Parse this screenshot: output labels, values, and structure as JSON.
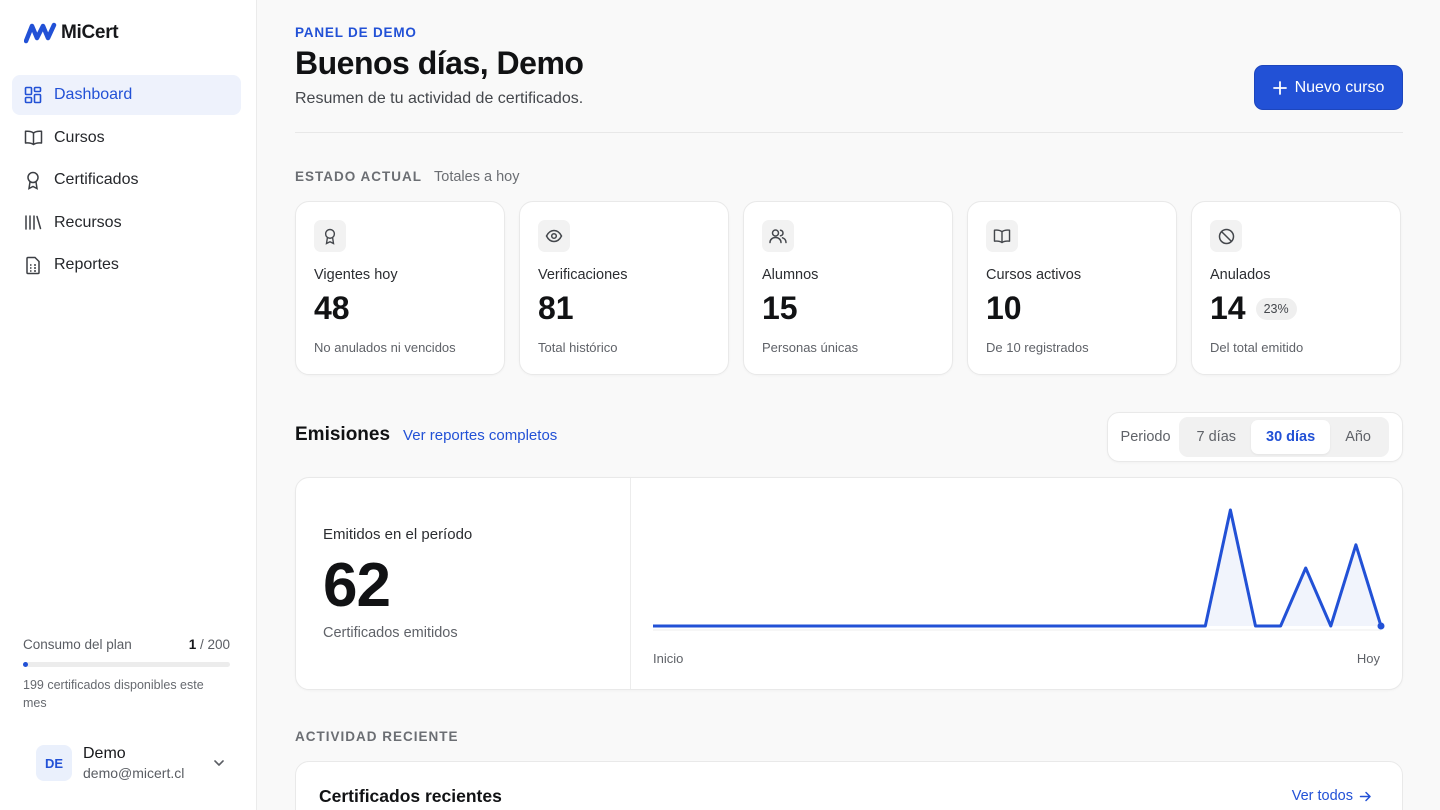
{
  "brand": {
    "name": "MiCert",
    "accent": "#2251d6"
  },
  "sidebar": {
    "items": [
      {
        "label": "Dashboard",
        "icon": "dashboard-grid-icon",
        "active": true
      },
      {
        "label": "Cursos",
        "icon": "book-open-icon"
      },
      {
        "label": "Certificados",
        "icon": "award-icon"
      },
      {
        "label": "Recursos",
        "icon": "library-icon"
      },
      {
        "label": "Reportes",
        "icon": "report-sheet-icon"
      }
    ],
    "plan": {
      "label": "Consumo del plan",
      "used": "1",
      "total": "/ 200",
      "usage_fraction": 0.005,
      "note": "199 certificados disponibles este mes"
    },
    "user": {
      "initials": "DE",
      "name": "Demo",
      "email": "demo@micert.cl"
    }
  },
  "header": {
    "eyebrow": "PANEL DE DEMO",
    "title": "Buenos días, Demo",
    "subtitle": "Resumen de tu actividad de certificados.",
    "new_course_label": "Nuevo curso"
  },
  "status": {
    "label": "ESTADO ACTUAL",
    "hint": "Totales a hoy",
    "cards": [
      {
        "icon": "award-icon",
        "label": "Vigentes hoy",
        "value": "48",
        "note": "No anulados ni vencidos"
      },
      {
        "icon": "eye-icon",
        "label": "Verificaciones",
        "value": "81",
        "note": "Total histórico"
      },
      {
        "icon": "users-icon",
        "label": "Alumnos",
        "value": "15",
        "note": "Personas únicas"
      },
      {
        "icon": "book-open-icon",
        "label": "Cursos activos",
        "value": "10",
        "note": "De 10 registrados"
      },
      {
        "icon": "ban-icon",
        "label": "Anulados",
        "value": "14",
        "badge": "23%",
        "note": "Del total emitido"
      }
    ]
  },
  "emissions": {
    "title": "Emisiones",
    "link": "Ver reportes completos",
    "period_label": "Periodo",
    "periods": [
      "7 días",
      "30 días",
      "Año"
    ],
    "active_period": "30 días",
    "kpi_label": "Emitidos en el período",
    "kpi_value": "62",
    "kpi_note": "Certificados emitidos",
    "axis_start": "Inicio",
    "axis_end": "Hoy"
  },
  "chart_data": {
    "type": "line",
    "x": [
      1,
      2,
      3,
      4,
      5,
      6,
      7,
      8,
      9,
      10,
      11,
      12,
      13,
      14,
      15,
      16,
      17,
      18,
      19,
      20,
      21,
      22,
      23,
      24,
      25,
      26,
      27,
      28,
      29,
      30
    ],
    "values": [
      0,
      0,
      0,
      0,
      0,
      0,
      0,
      0,
      0,
      0,
      0,
      0,
      0,
      0,
      0,
      0,
      0,
      0,
      0,
      0,
      0,
      0,
      0,
      30,
      0,
      0,
      15,
      0,
      21,
      0
    ],
    "xlabel": "",
    "ylabel": "",
    "ylim": [
      0,
      30
    ],
    "grid": false,
    "color": "#2251d6"
  },
  "recent": {
    "section_label": "ACTIVIDAD RECIENTE",
    "title": "Certificados recientes",
    "link": "Ver todos"
  }
}
